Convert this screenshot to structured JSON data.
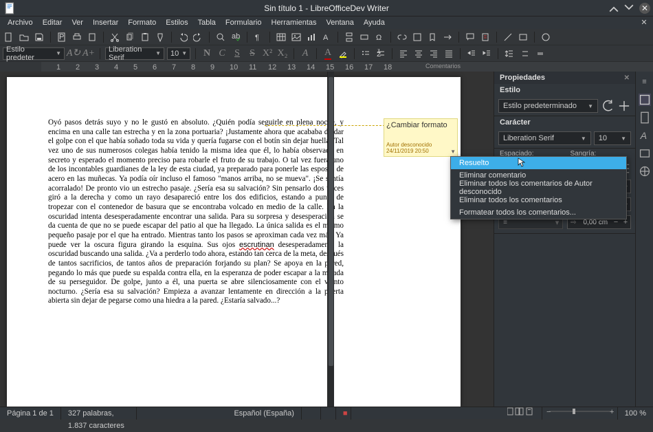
{
  "window": {
    "title": "Sin título 1 - LibreOfficeDev Writer"
  },
  "menu": [
    "Archivo",
    "Editar",
    "Ver",
    "Insertar",
    "Formato",
    "Estilos",
    "Tabla",
    "Formulario",
    "Herramientas",
    "Ventana",
    "Ayuda"
  ],
  "toolbar2": {
    "paragraph_style": "Estilo predeter",
    "font_name": "Liberation Serif",
    "font_size": "10"
  },
  "ruler": {
    "ticks": [
      "1",
      "2",
      "3",
      "4",
      "5",
      "6",
      "7",
      "8",
      "9",
      "10",
      "11",
      "12",
      "13",
      "14",
      "15",
      "16",
      "17",
      "18"
    ],
    "comments_label": "Comentarios"
  },
  "document": {
    "body_html": "Oyó pasos detrás suyo y no le gustó en absoluto. ¿Quién podía seguirle en plena noche, y encima en una calle tan estrecha y en la zona portuaria? ¡Justamente ahora que acababa de dar el golpe con el que había soñado toda su vida y quería fugarse con el botín sin dejar huella! Tal vez uno de sus numerosos colegas había tenido la misma idea que él, lo había observado en secreto y esperado el momento preciso para robarle el fruto de su trabajo. O tal vez fuera uno de los incontables guardianes de la ley de esta ciudad, ya preparado para ponerle las esposas de acero en las muñecas. Ya podía oír incluso el famoso  \"manos arriba, no se mueva\". ¡Se sentía acorralado! De pronto vio un estrecho pasaje. ¿Sería esa su salvación? Sin pensarlo dos veces giró a la derecha y como un rayo desapareció entre los dos edificios, estando a punto de tropezar con el contenedor de basura que se encontraba volcado en medio de la calle. En la oscuridad intenta desesperadamente encontrar una salida. Para su sorpresa y desesperación se da cuenta de que no se puede escapar del patio al que ha llegado. La única salida es el mismo pequeño pasaje por el que ha entrado. Mientras tanto los pasos se aproximan cada vez más. Ya puede ver la oscura figura girando la esquina. Sus ojos <u>escrutinan</u> desesperadamente la oscuridad buscando una salida. ¿Va a perderlo todo ahora, estando tan cerca de la meta, después de tantos sacrificios, de tantos años de preparación forjando su plan? Se apoya en la pared, pegando lo más que puede su espalda contra ella, en la esperanza de poder escapar a la mirada de su perseguidor. De golpe, junto a él, una puerta se abre silenciosamente con el viento nocturno. ¿Sería esa su salvación? Empieza a avanzar lentamente en dirección a la puerta abierta sin dejar de pegarse como una hiedra a la pared. ¿Estaría salvado...?"
  },
  "comment": {
    "title": "¿Cambiar formato",
    "author": "Autor desconocido",
    "date": "24/11/2019 20:50"
  },
  "context_menu": [
    "Resuelto",
    "Eliminar comentario",
    "Eliminar todos los comentarios de Autor desconocido",
    "Eliminar todos los comentarios",
    "Formatear todos los comentarios..."
  ],
  "sidebar": {
    "title": "Propiedades",
    "style": {
      "label": "Estilo",
      "value": "Estilo predeterminado"
    },
    "char": {
      "label": "Carácter",
      "font": "Liberation Serif",
      "size": "10"
    },
    "spacing": {
      "label_left": "Espaciado:",
      "label_right": "Sangría:"
    },
    "spin_value": "0,00 cm"
  },
  "status": {
    "page": "Página 1 de 1",
    "words": "327 palabras, 1.837 caracteres",
    "lang": "Español (España)",
    "zoom": "100 %"
  }
}
